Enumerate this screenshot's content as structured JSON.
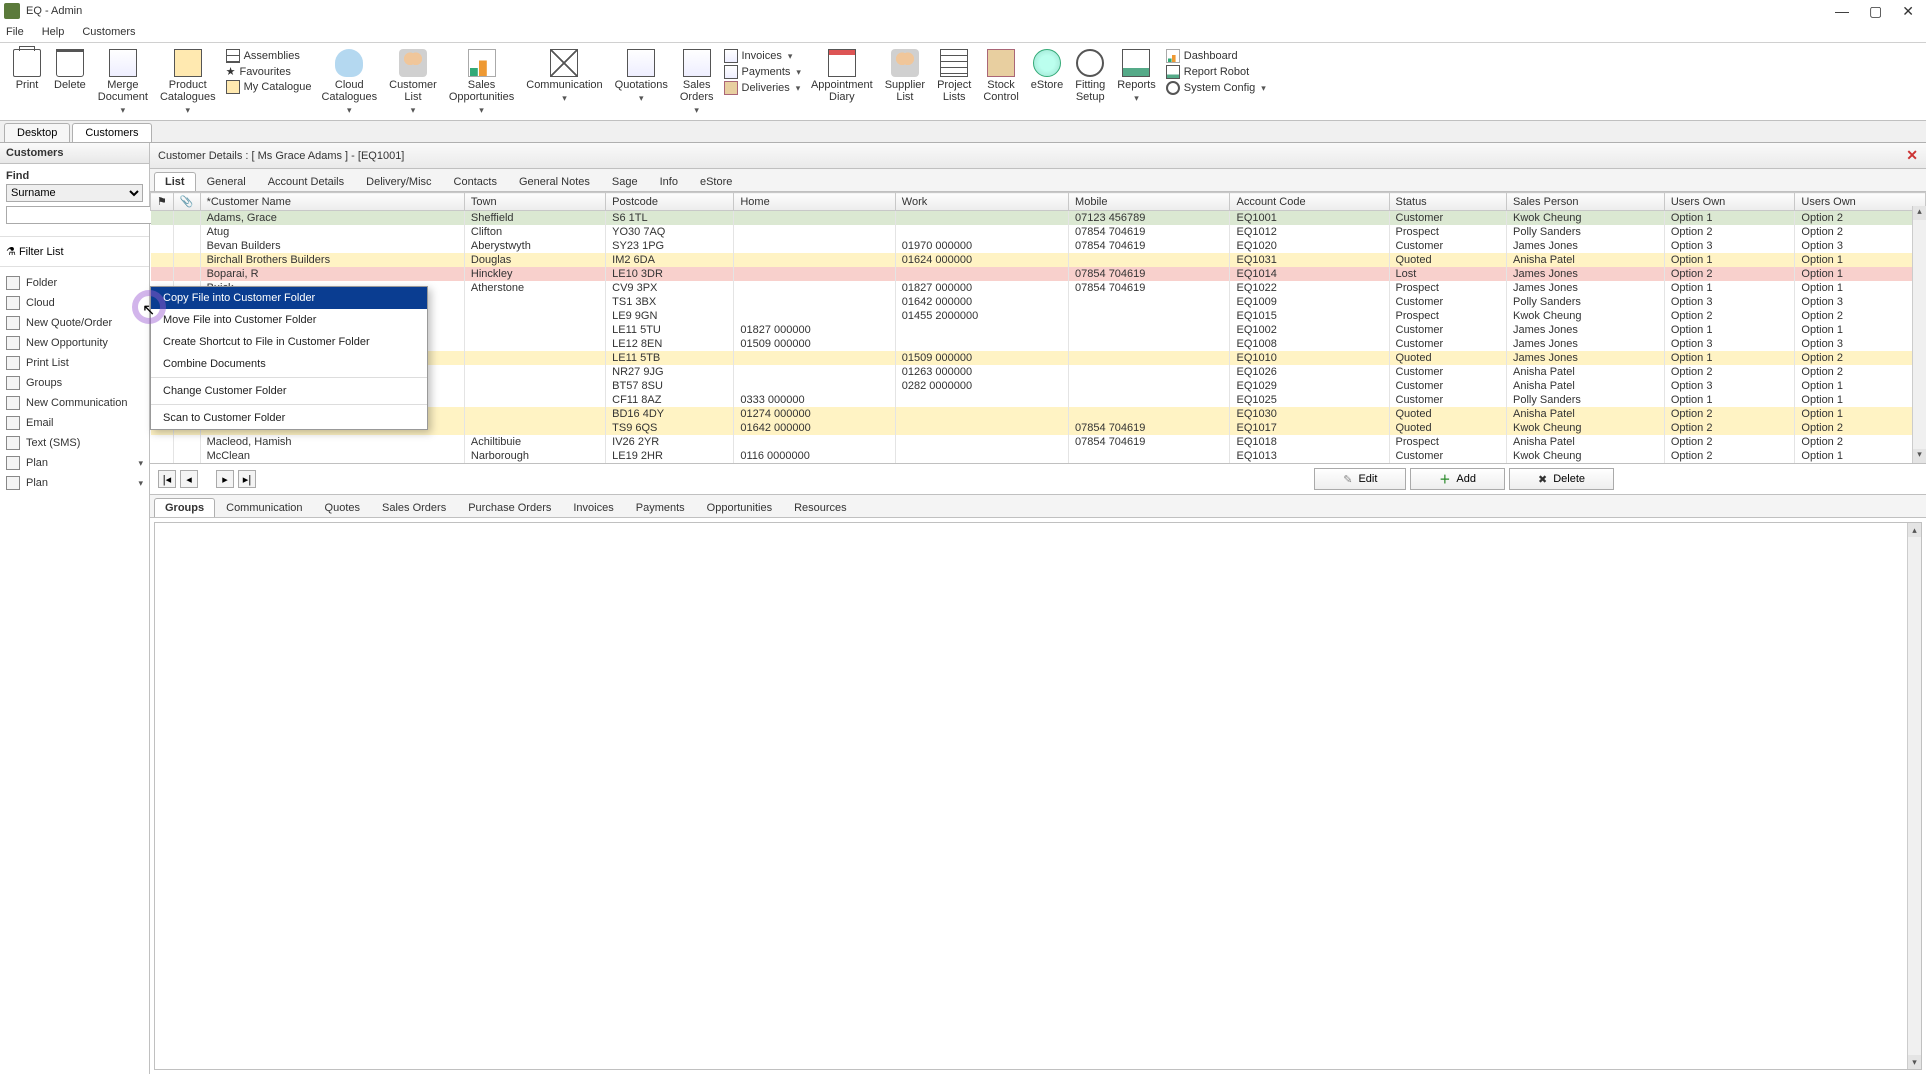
{
  "window": {
    "title": "EQ - Admin"
  },
  "menu": {
    "file": "File",
    "help": "Help",
    "customers": "Customers"
  },
  "ribbon": {
    "print": "Print",
    "delete": "Delete",
    "merge": "Merge\nDocument",
    "product_cat": "Product\nCatalogues",
    "assemblies": "Assemblies",
    "favourites": "Favourites",
    "my_catalogue": "My Catalogue",
    "cloud_cat": "Cloud\nCatalogues",
    "customer_list": "Customer\nList",
    "sales_opp": "Sales\nOpportunities",
    "communication": "Communication",
    "quotations": "Quotations",
    "sales_orders": "Sales\nOrders",
    "invoices": "Invoices",
    "payments": "Payments",
    "deliveries": "Deliveries",
    "appt_diary": "Appointment\nDiary",
    "supplier_list": "Supplier\nList",
    "project_lists": "Project\nLists",
    "stock_control": "Stock\nControl",
    "estore": "eStore",
    "fitting_setup": "Fitting\nSetup",
    "reports": "Reports",
    "dashboard": "Dashboard",
    "report_robot": "Report Robot",
    "system_config": "System Config"
  },
  "tabs": {
    "desktop": "Desktop",
    "customers": "Customers"
  },
  "sidebar": {
    "header": "Customers",
    "find": "Find",
    "find_field": "Surname",
    "filter": "Filter List",
    "items": {
      "folder": "Folder",
      "cloud": "Cloud",
      "new_quote": "New Quote/Order",
      "new_opp": "New Opportunity",
      "print_list": "Print List",
      "groups": "Groups",
      "new_comm": "New Communication",
      "email": "Email",
      "sms": "Text (SMS)",
      "plan1": "Plan",
      "plan2": "Plan"
    }
  },
  "details_header": "Customer Details :  [ Ms Grace Adams ]  -  [EQ1001]",
  "detail_tabs": [
    "List",
    "General",
    "Account Details",
    "Delivery/Misc",
    "Contacts",
    "General Notes",
    "Sage",
    "Info",
    "eStore"
  ],
  "columns": [
    "",
    "",
    "*Customer Name",
    "Town",
    "Postcode",
    "Home",
    "Work",
    "Mobile",
    "Account Code",
    "Status",
    "Sales Person",
    "Users Own",
    "Users Own"
  ],
  "rows": [
    {
      "cls": "sel",
      "name": "Adams, Grace",
      "town": "Sheffield",
      "pc": "S6 1TL",
      "home": "",
      "work": "",
      "mob": "07123 456789",
      "acc": "EQ1001",
      "status": "Customer",
      "sp": "Kwok Cheung",
      "u1": "Option 1",
      "u2": "Option 2"
    },
    {
      "cls": "prospect",
      "name": "Atug",
      "town": "Clifton",
      "pc": "YO30 7AQ",
      "home": "",
      "work": "",
      "mob": "07854 704619",
      "acc": "EQ1012",
      "status": "Prospect",
      "sp": "Polly Sanders",
      "u1": "Option 2",
      "u2": "Option 2"
    },
    {
      "cls": "customer",
      "name": "Bevan Builders",
      "town": "Aberystwyth",
      "pc": "SY23 1PG",
      "home": "",
      "work": "01970 000000",
      "mob": "07854 704619",
      "acc": "EQ1020",
      "status": "Customer",
      "sp": "James Jones",
      "u1": "Option 3",
      "u2": "Option 3"
    },
    {
      "cls": "quoted",
      "name": "Birchall Brothers Builders",
      "town": "Douglas",
      "pc": "IM2 6DA",
      "home": "",
      "work": "01624 000000",
      "mob": "",
      "acc": "EQ1031",
      "status": "Quoted",
      "sp": "Anisha Patel",
      "u1": "Option 1",
      "u2": "Option 1"
    },
    {
      "cls": "lost",
      "name": "Boparai, R",
      "town": "Hinckley",
      "pc": "LE10 3DR",
      "home": "",
      "work": "",
      "mob": "07854 704619",
      "acc": "EQ1014",
      "status": "Lost",
      "sp": "James Jones",
      "u1": "Option 2",
      "u2": "Option 1"
    },
    {
      "cls": "prospect",
      "name": "Buick",
      "town": "Atherstone",
      "pc": "CV9 3PX",
      "home": "",
      "work": "01827 000000",
      "mob": "07854 704619",
      "acc": "EQ1022",
      "status": "Prospect",
      "sp": "James Jones",
      "u1": "Option 1",
      "u2": "Option 1"
    },
    {
      "cls": "customer",
      "name": "",
      "town": "",
      "pc": "TS1 3BX",
      "home": "",
      "work": "01642 000000",
      "mob": "",
      "acc": "EQ1009",
      "status": "Customer",
      "sp": "Polly Sanders",
      "u1": "Option 3",
      "u2": "Option 3"
    },
    {
      "cls": "prospect",
      "name": "",
      "town": "",
      "pc": "LE9 9GN",
      "home": "",
      "work": "01455 2000000",
      "mob": "",
      "acc": "EQ1015",
      "status": "Prospect",
      "sp": "Kwok Cheung",
      "u1": "Option 2",
      "u2": "Option 2"
    },
    {
      "cls": "customer",
      "name": "",
      "town": "",
      "pc": "LE11 5TU",
      "home": "01827 000000",
      "work": "",
      "mob": "",
      "acc": "EQ1002",
      "status": "Customer",
      "sp": "James Jones",
      "u1": "Option 1",
      "u2": "Option 1"
    },
    {
      "cls": "customer",
      "name": "",
      "town": "",
      "pc": "LE12 8EN",
      "home": "01509 000000",
      "work": "",
      "mob": "",
      "acc": "EQ1008",
      "status": "Customer",
      "sp": "James Jones",
      "u1": "Option 3",
      "u2": "Option 3"
    },
    {
      "cls": "quoted",
      "name": "",
      "town": "",
      "pc": "LE11 5TB",
      "home": "",
      "work": "01509 000000",
      "mob": "",
      "acc": "EQ1010",
      "status": "Quoted",
      "sp": "James Jones",
      "u1": "Option 1",
      "u2": "Option 2"
    },
    {
      "cls": "customer",
      "name": "",
      "town": "",
      "pc": "NR27 9JG",
      "home": "",
      "work": "01263 000000",
      "mob": "",
      "acc": "EQ1026",
      "status": "Customer",
      "sp": "Anisha Patel",
      "u1": "Option 2",
      "u2": "Option 2"
    },
    {
      "cls": "customer",
      "name": "",
      "town": "",
      "pc": "BT57 8SU",
      "home": "",
      "work": "0282 0000000",
      "mob": "",
      "acc": "EQ1029",
      "status": "Customer",
      "sp": "Anisha Patel",
      "u1": "Option 3",
      "u2": "Option 1"
    },
    {
      "cls": "customer",
      "name": "",
      "town": "",
      "pc": "CF11 8AZ",
      "home": "0333 000000",
      "work": "",
      "mob": "",
      "acc": "EQ1025",
      "status": "Customer",
      "sp": "Polly Sanders",
      "u1": "Option 1",
      "u2": "Option 1"
    },
    {
      "cls": "quoted",
      "name": "",
      "town": "",
      "pc": "BD16 4DY",
      "home": "01274 000000",
      "work": "",
      "mob": "",
      "acc": "EQ1030",
      "status": "Quoted",
      "sp": "Anisha Patel",
      "u1": "Option 2",
      "u2": "Option 1"
    },
    {
      "cls": "quoted",
      "name": "",
      "town": "",
      "pc": "TS9 6QS",
      "home": "01642 000000",
      "work": "",
      "mob": "07854 704619",
      "acc": "EQ1017",
      "status": "Quoted",
      "sp": "Kwok Cheung",
      "u1": "Option 2",
      "u2": "Option 2"
    },
    {
      "cls": "prospect",
      "name": "Macleod, Hamish",
      "town": "Achiltibuie",
      "pc": "IV26 2YR",
      "home": "",
      "work": "",
      "mob": "07854 704619",
      "acc": "EQ1018",
      "status": "Prospect",
      "sp": "Anisha Patel",
      "u1": "Option 2",
      "u2": "Option 2"
    },
    {
      "cls": "customer",
      "name": "McClean",
      "town": "Narborough",
      "pc": "LE19 2HR",
      "home": "0116 0000000",
      "work": "",
      "mob": "",
      "acc": "EQ1013",
      "status": "Customer",
      "sp": "Kwok Cheung",
      "u1": "Option 2",
      "u2": "Option 1"
    }
  ],
  "pager": {
    "edit": "Edit",
    "add": "Add",
    "delete": "Delete"
  },
  "bottom_tabs": [
    "Groups",
    "Communication",
    "Quotes",
    "Sales Orders",
    "Purchase Orders",
    "Invoices",
    "Payments",
    "Opportunities",
    "Resources"
  ],
  "context_menu": {
    "copy": "Copy File into Customer Folder",
    "move": "Move File into Customer Folder",
    "shortcut": "Create Shortcut to File in Customer Folder",
    "combine": "Combine Documents",
    "change": "Change Customer Folder",
    "scan": "Scan to Customer Folder"
  }
}
